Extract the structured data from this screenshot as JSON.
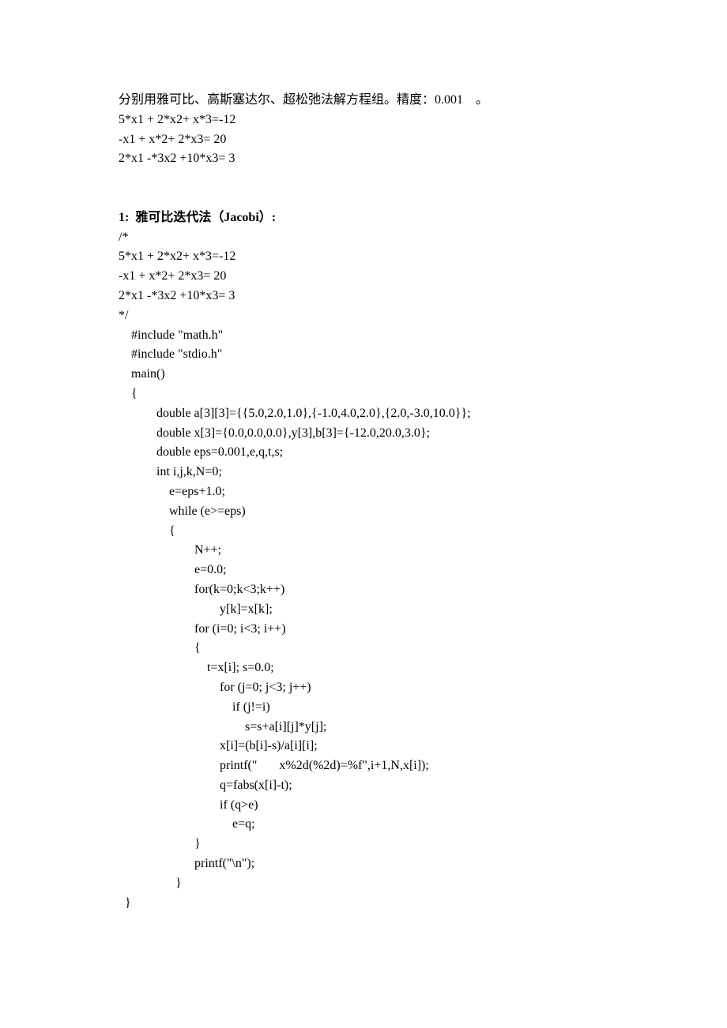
{
  "intro": {
    "l1": "分别用雅可比、高斯塞达尔、超松弛法解方程组。精度：0.001    。",
    "l2": "5*x1 + 2*x2+ x*3=-12",
    "l3": "-x1 + x*2+ 2*x3= 20",
    "l4": "2*x1 -*3x2 +10*x3= 3"
  },
  "section1": {
    "title": "1:  雅可比迭代法（Jacobi）:",
    "l1": "/*",
    "l2": "5*x1 + 2*x2+ x*3=-12",
    "l3": "-x1 + x*2+ 2*x3= 20",
    "l4": "2*x1 -*3x2 +10*x3= 3",
    "l5": "*/",
    "c1": "    #include \"math.h\"",
    "c2": "    #include \"stdio.h\"",
    "c3": "    main()",
    "c4": "    {",
    "c5": "            double a[3][3]={{5.0,2.0,1.0},{-1.0,4.0,2.0},{2.0,-3.0,10.0}};",
    "c6": "            double x[3]={0.0,0.0,0.0},y[3],b[3]={-12.0,20.0,3.0};",
    "c7": "            double eps=0.001,e,q,t,s;",
    "c8": "            int i,j,k,N=0;",
    "c9": "                e=eps+1.0;",
    "c10": "                while (e>=eps)",
    "c11": "                {",
    "c12": "                        N++;",
    "c13": "                        e=0.0;",
    "c14": "                        for(k=0;k<3;k++)",
    "c15": "                                y[k]=x[k];",
    "c16": "                        for (i=0; i<3; i++)",
    "c17": "                        {",
    "c18": "                            t=x[i]; s=0.0;",
    "c19": "                                for (j=0; j<3; j++)",
    "c20": "                                    if (j!=i)",
    "c21": "                                        s=s+a[i][j]*y[j];",
    "c22": "                                x[i]=(b[i]-s)/a[i][i];",
    "c23": "                                printf(\"       x%2d(%2d)=%f\",i+1,N,x[i]);",
    "c24": "                                q=fabs(x[i]-t);",
    "c25": "                                if (q>e)",
    "c26": "                                    e=q;",
    "c27": "                        }",
    "c28": "                        printf(\"\\n\");",
    "c29": "                  }",
    "c30": "  }"
  }
}
